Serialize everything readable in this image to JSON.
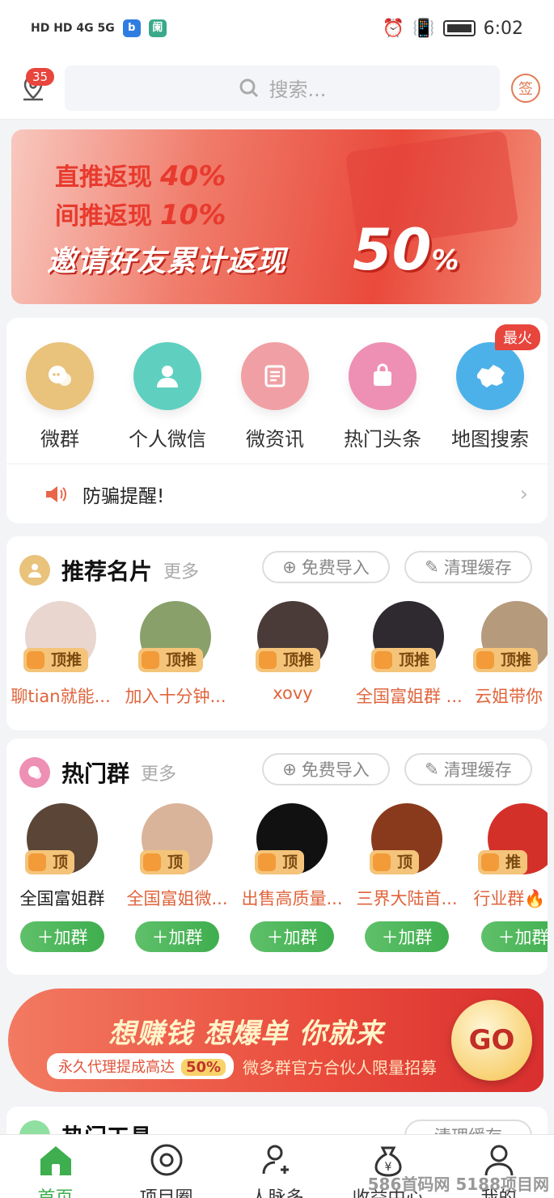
{
  "status": {
    "left_indicators": "HD HD 4G 5G",
    "time": "6:02"
  },
  "topbar": {
    "location_badge": "35",
    "search_placeholder": "搜索...",
    "sign_label": "签"
  },
  "banner": {
    "line1": "直推返现",
    "line1_pct": "40%",
    "line2": "间推返现",
    "line2_pct": "10%",
    "line3": "邀请好友累计返现",
    "big_pct": "50",
    "big_unit": "%"
  },
  "quick": {
    "badge": "最火",
    "items": [
      {
        "label": "微群",
        "icon": "chat-bubbles-icon",
        "color": "#e9c27c"
      },
      {
        "label": "个人微信",
        "icon": "person-icon",
        "color": "#5fd0c0"
      },
      {
        "label": "微资讯",
        "icon": "news-icon",
        "color": "#f0a0a4"
      },
      {
        "label": "热门头条",
        "icon": "bag-icon",
        "color": "#ee8fb4"
      },
      {
        "label": "地图搜索",
        "icon": "china-map-icon",
        "color": "#4db1e9"
      }
    ],
    "notice": "防骗提醒!"
  },
  "cards_section": {
    "title": "推荐名片",
    "more": "更多",
    "import": "免费导入",
    "clear": "清理缓存",
    "items": [
      {
        "name": "聊tian就能...",
        "tag": "顶推",
        "color": "#e9d6cf"
      },
      {
        "name": "加入十分钟...",
        "tag": "顶推",
        "color": "#8aa06a"
      },
      {
        "name": "xovy",
        "tag": "顶推",
        "color": "#4a3a38"
      },
      {
        "name": "全国富姐群 ...",
        "tag": "顶推",
        "color": "#2e2a30"
      },
      {
        "name": "云姐带你",
        "tag": "顶推",
        "color": "#b69a7c"
      }
    ]
  },
  "groups_section": {
    "title": "热门群",
    "more": "更多",
    "import": "免费导入",
    "clear": "清理缓存",
    "add_label": "加群",
    "items": [
      {
        "name": "全国富姐群",
        "tag": "顶",
        "color": "#5a4536"
      },
      {
        "name": "全国富姐微...",
        "tag": "顶",
        "color": "#d9b49a"
      },
      {
        "name": "出售高质量...",
        "tag": "顶",
        "color": "#111111"
      },
      {
        "name": "三界大陆首...",
        "tag": "顶",
        "color": "#8a3a1c"
      },
      {
        "name": "行业群🔥",
        "tag": "推",
        "color": "#d4302a"
      }
    ]
  },
  "promo": {
    "title": "想赚钱 想爆单 你就来",
    "sub": "永久代理提成高达",
    "sub_pct": "50%",
    "recruit": "微多群官方合伙人限量招募",
    "go": "GO"
  },
  "tools_section": {
    "title": "热门工具",
    "clear": "清理缓存"
  },
  "tabs": [
    {
      "label": "首页",
      "icon": "home-icon"
    },
    {
      "label": "项目圈",
      "icon": "circle-gear-icon"
    },
    {
      "label": "人脉多",
      "icon": "add-person-icon"
    },
    {
      "label": "收益中心",
      "icon": "money-bag-icon"
    },
    {
      "label": "我的",
      "icon": "user-icon"
    }
  ],
  "watermark": "586首码网 5188项目网"
}
